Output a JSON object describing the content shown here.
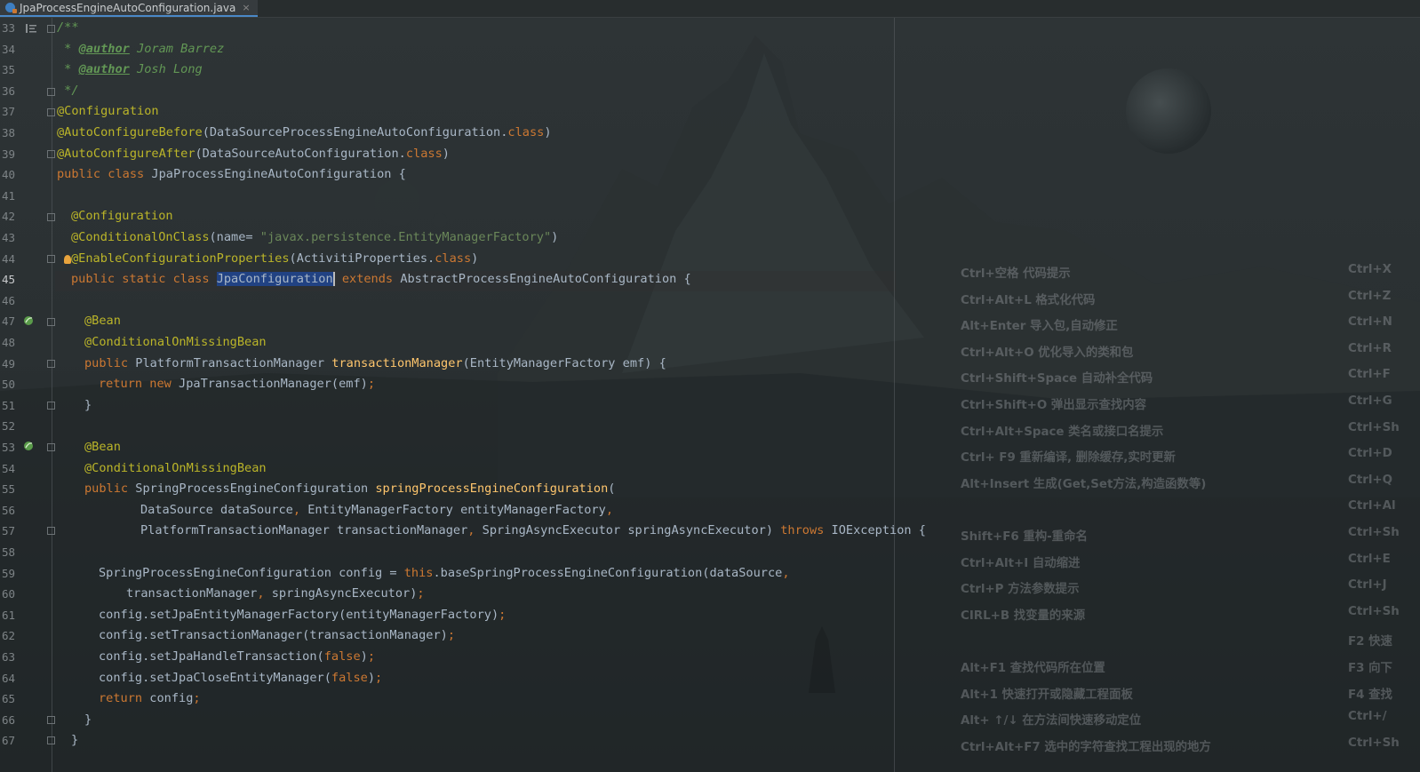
{
  "tab": {
    "title": "JpaProcessEngineAutoConfiguration.java",
    "close": "×"
  },
  "gutter": {
    "line_numbers": [
      "33",
      "34",
      "35",
      "36",
      "37",
      "38",
      "39",
      "40",
      "41",
      "42",
      "43",
      "44",
      "45",
      "46",
      "47",
      "48",
      "49",
      "50",
      "51",
      "52",
      "53",
      "54",
      "55",
      "56",
      "57",
      "58",
      "59",
      "60",
      "61",
      "62",
      "63",
      "64",
      "65",
      "66",
      "67"
    ],
    "current_line": "45"
  },
  "code": {
    "l33": "/**",
    "l34_star": " * ",
    "l34_tag": "@author",
    "l34_name": " Joram Barrez",
    "l35_star": " * ",
    "l35_tag": "@author",
    "l35_name": " Josh Long",
    "l36": " */",
    "l37": "@Configuration",
    "l38_ann": "@AutoConfigureBefore",
    "l38_arg": "(DataSourceProcessEngineAutoConfiguration.",
    "l38_kw": "class",
    "l38_end": ")",
    "l39_ann": "@AutoConfigureAfter",
    "l39_arg": "(DataSourceAutoConfiguration.",
    "l39_kw": "class",
    "l39_end": ")",
    "l40_kw": "public class ",
    "l40_rest": "JpaProcessEngineAutoConfiguration {",
    "l42": "@Configuration",
    "l43_ann": "@ConditionalOnClass",
    "l43_open": "(name= ",
    "l43_str": "\"javax.persistence.EntityManagerFactory\"",
    "l43_end": ")",
    "l44_ann": "@EnableConfigurationProperties",
    "l44_arg": "(ActivitiProperties.",
    "l44_kw": "class",
    "l44_end": ")",
    "l45_kw": "public static class ",
    "l45_sel": "JpaConfiguration",
    "l45_kw2": " extends ",
    "l45_rest": "AbstractProcessEngineAutoConfiguration {",
    "l47": "@Bean",
    "l48": "@ConditionalOnMissingBean",
    "l49_kw": "public ",
    "l49_type": "PlatformTransactionManager ",
    "l49_fn": "transactionManager",
    "l49_rest": "(EntityManagerFactory emf) {",
    "l50_kw": "return new ",
    "l50_rest": "JpaTransactionManager(emf)",
    "l50_semi": ";",
    "l51": "}",
    "l53": "@Bean",
    "l54": "@ConditionalOnMissingBean",
    "l55_kw": "public ",
    "l55_type": "SpringProcessEngineConfiguration ",
    "l55_fn": "springProcessEngineConfiguration",
    "l55_rest": "(",
    "l56_a": "DataSource dataSource",
    "l56_c1": ", ",
    "l56_b": "EntityManagerFactory entityManagerFactory",
    "l56_c2": ",",
    "l57_a": "PlatformTransactionManager transactionManager",
    "l57_c1": ", ",
    "l57_b": "SpringAsyncExecutor springAsyncExecutor) ",
    "l57_kw": "throws ",
    "l57_rest": "IOException {",
    "l59_a": "SpringProcessEngineConfiguration config = ",
    "l59_kw": "this",
    "l59_b": ".baseSpringProcessEngineConfiguration(dataSource",
    "l59_c": ",",
    "l60_a": "transactionManager",
    "l60_c": ", ",
    "l60_b": "springAsyncExecutor)",
    "l60_semi": ";",
    "l61_a": "config.setJpaEntityManagerFactory(entityManagerFactory)",
    "l61_semi": ";",
    "l62_a": "config.setTransactionManager(transactionManager)",
    "l62_semi": ";",
    "l63_a": "config.setJpaHandleTransaction(",
    "l63_kw": "false",
    "l63_b": ")",
    "l63_semi": ";",
    "l64_a": "config.setJpaCloseEntityManager(",
    "l64_kw": "false",
    "l64_b": ")",
    "l64_semi": ";",
    "l65_kw": "return ",
    "l65_a": "config",
    "l65_semi": ";",
    "l66": "}",
    "l67": "}"
  },
  "shortcuts_left": [
    "Ctrl+空格  代码提示",
    "Ctrl+Alt+L  格式化代码",
    "Alt+Enter 导入包,自动修正",
    "Ctrl+Alt+O  优化导入的类和包",
    "Ctrl+Shift+Space 自动补全代码",
    "Ctrl+Shift+O  弹出显示查找内容",
    "Ctrl+Alt+Space  类名或接口名提示",
    " Ctrl+ F9 重新编译, 删除缓存,实时更新",
    "Alt+Insert  生成(Get,Set方法,构造函数等)",
    "",
    "Shift+F6  重构-重命名",
    "Ctrl+Alt+I  自动缩进",
    "Ctrl+P   方法参数提示",
    "CIRL+B   找变量的来源",
    "",
    "Alt+F1 查找代码所在位置",
    "Alt+1 快速打开或隐藏工程面板",
    "Alt+ ↑/↓ 在方法间快速移动定位",
    "Ctrl+Alt+F7  选中的字符查找工程出现的地方"
  ],
  "shortcuts_right": [
    "Ctrl+X",
    "Ctrl+Z",
    "Ctrl+N",
    "Ctrl+R",
    "Ctrl+F",
    "Ctrl+G",
    "Ctrl+Sh",
    "Ctrl+D",
    "Ctrl+Q",
    "Ctrl+Al",
    "Ctrl+Sh",
    "Ctrl+E",
    "Ctrl+J",
    "Ctrl+Sh",
    "F2  快速",
    "F3   向下",
    "F4   查找",
    "Ctrl+/",
    "Ctrl+Sh"
  ],
  "colors": {
    "keyword": "#cc7832",
    "annotation": "#bbb529",
    "string": "#6a8759",
    "comment": "#629755",
    "method": "#ffc66d",
    "text": "#a9b7c6",
    "selection": "#214283"
  }
}
